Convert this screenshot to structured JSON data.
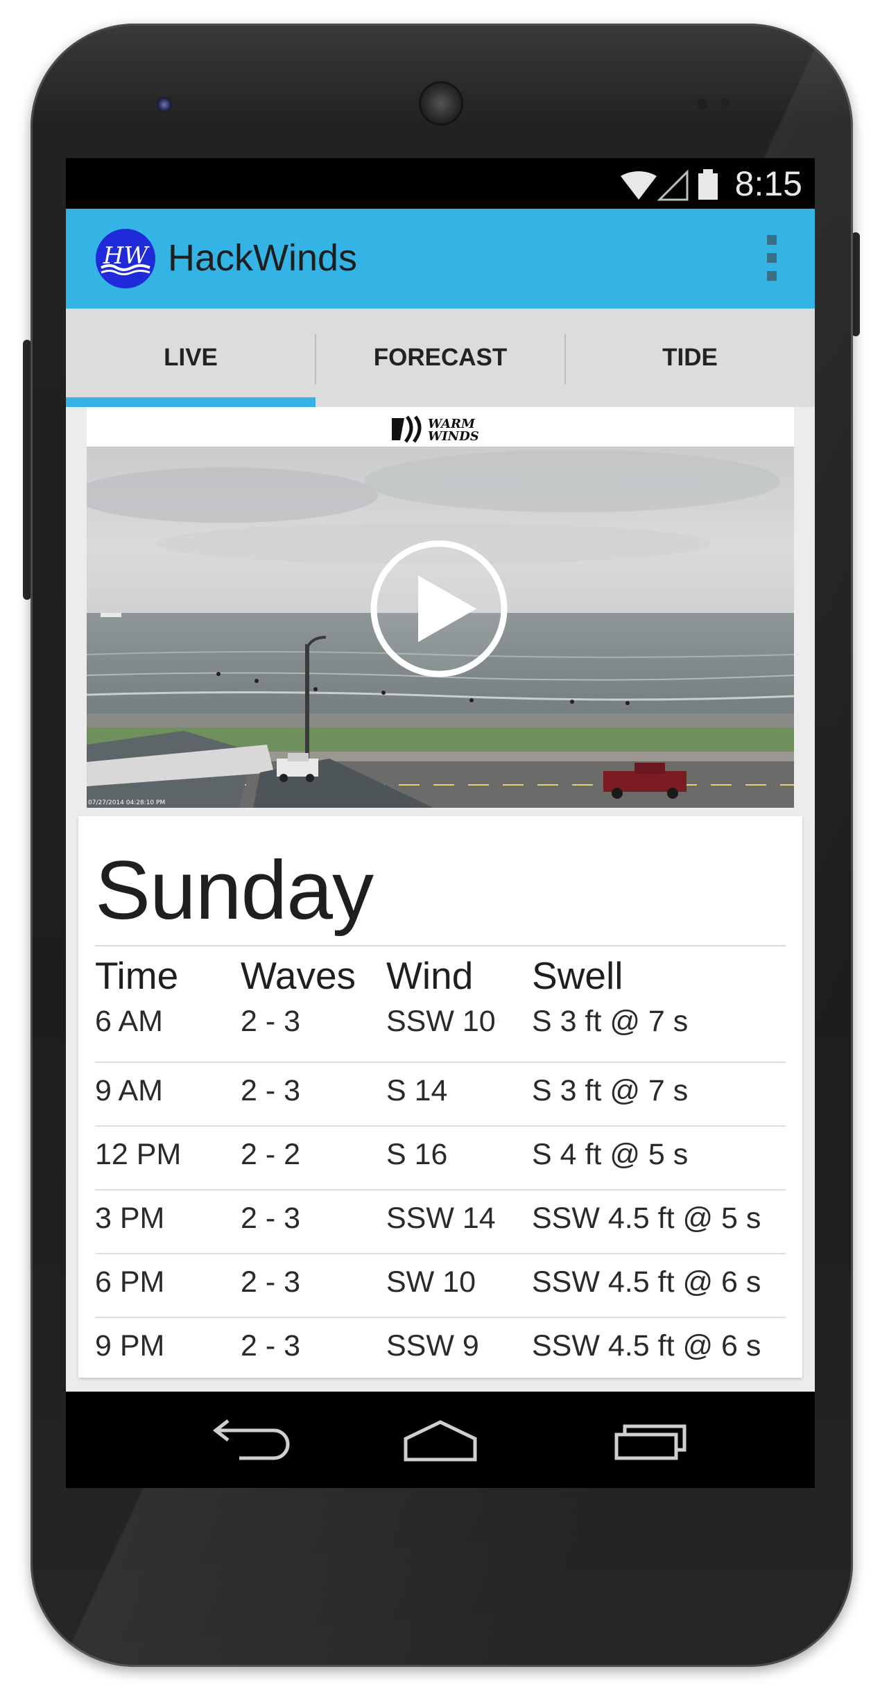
{
  "status_bar": {
    "time": "8:15",
    "icons": [
      "wifi-icon",
      "cell-signal-icon",
      "battery-icon"
    ]
  },
  "action_bar": {
    "logo_text": "HW",
    "title": "HackWinds",
    "menu_icon": "overflow-menu-icon",
    "color": "#33b4e5"
  },
  "tabs": [
    {
      "label": "LIVE",
      "active": true
    },
    {
      "label": "FORECAST",
      "active": false
    },
    {
      "label": "TIDE",
      "active": false
    }
  ],
  "camera": {
    "brand_line1": "WARM",
    "brand_line2": "WINDS",
    "timestamp": "07/27/2014 04:28:10 PM",
    "play_icon": "play-icon"
  },
  "forecast": {
    "day": "Sunday",
    "headers": [
      "Time",
      "Waves",
      "Wind",
      "Swell"
    ],
    "rows": [
      [
        "6 AM",
        "2 - 3",
        "SSW 10",
        "S 3 ft @ 7 s"
      ],
      [
        "9 AM",
        "2 - 3",
        "S 14",
        "S 3 ft @ 7 s"
      ],
      [
        "12 PM",
        "2 - 2",
        "S 16",
        "S 4 ft @ 5 s"
      ],
      [
        "3 PM",
        "2 - 3",
        "SSW 14",
        "SSW 4.5 ft @ 5 s"
      ],
      [
        "6 PM",
        "2 - 3",
        "SW 10",
        "SSW 4.5 ft @ 6 s"
      ],
      [
        "9 PM",
        "2 - 3",
        "SSW 9",
        "SSW 4.5 ft @ 6 s"
      ]
    ]
  },
  "nav_bar": {
    "buttons": [
      "back-icon",
      "home-icon",
      "recents-icon"
    ]
  }
}
